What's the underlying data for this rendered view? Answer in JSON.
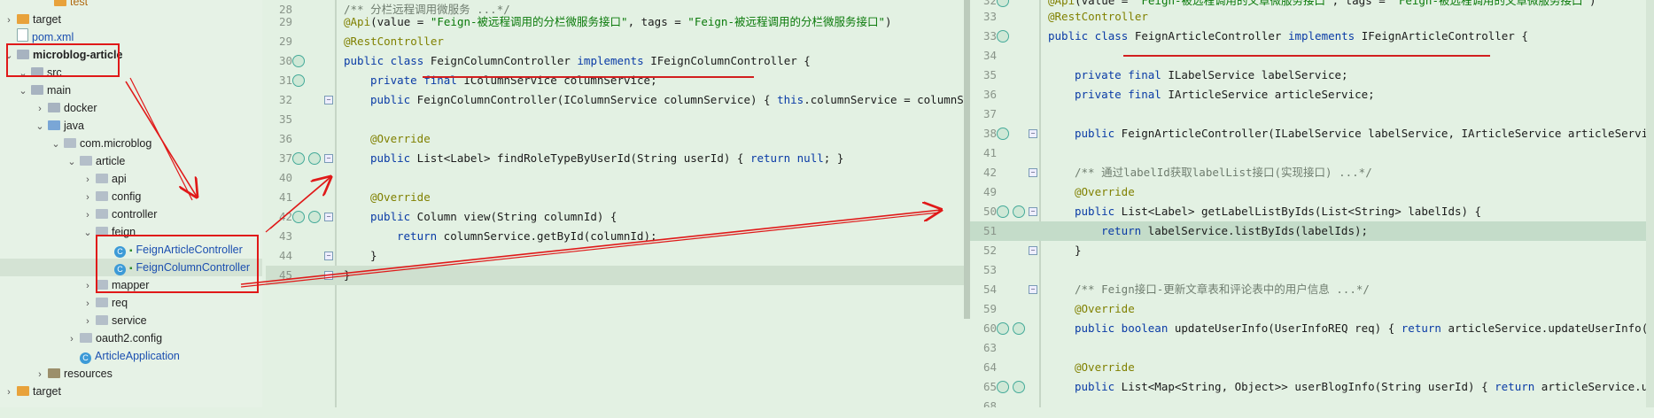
{
  "tree": [
    {
      "label": "test",
      "icon": "orange",
      "indent": 42,
      "chev": "",
      "cls": "orange"
    },
    {
      "label": "target",
      "icon": "orange",
      "indent": 0,
      "chev": "›"
    },
    {
      "label": "pom.xml",
      "icon": "file",
      "indent": 0,
      "chev": "",
      "cls": "blue"
    },
    {
      "label": "microblog-article",
      "icon": "folder",
      "indent": 0,
      "chev": "⌄",
      "cls": "bold"
    },
    {
      "label": "src",
      "icon": "folder",
      "indent": 16,
      "chev": "⌄"
    },
    {
      "label": "main",
      "icon": "folder",
      "indent": 16,
      "chev": "⌄"
    },
    {
      "label": "docker",
      "icon": "folder",
      "indent": 35,
      "chev": "›"
    },
    {
      "label": "java",
      "icon": "src",
      "indent": 35,
      "chev": "⌄"
    },
    {
      "label": "com.microblog",
      "icon": "pkg",
      "indent": 53,
      "chev": "⌄"
    },
    {
      "label": "article",
      "icon": "pkg",
      "indent": 71,
      "chev": "⌄"
    },
    {
      "label": "api",
      "icon": "pkg",
      "indent": 89,
      "chev": "›"
    },
    {
      "label": "config",
      "icon": "pkg",
      "indent": 89,
      "chev": "›"
    },
    {
      "label": "controller",
      "icon": "pkg",
      "indent": 89,
      "chev": "›"
    },
    {
      "label": "feign",
      "icon": "pkg",
      "indent": 89,
      "chev": "⌄"
    },
    {
      "label": "FeignArticleController",
      "icon": "cls",
      "indent": 110,
      "chev": "",
      "cls": "blue",
      "lock": true
    },
    {
      "label": "FeignColumnController",
      "icon": "cls",
      "indent": 110,
      "chev": "",
      "cls": "blue",
      "lock": true,
      "sel": true
    },
    {
      "label": "mapper",
      "icon": "pkg",
      "indent": 89,
      "chev": "›"
    },
    {
      "label": "req",
      "icon": "pkg",
      "indent": 89,
      "chev": "›"
    },
    {
      "label": "service",
      "icon": "pkg",
      "indent": 89,
      "chev": "›"
    },
    {
      "label": "oauth2.config",
      "icon": "pkg",
      "indent": 71,
      "chev": "›"
    },
    {
      "label": "ArticleApplication",
      "icon": "cls",
      "indent": 71,
      "chev": "",
      "cls": "blue"
    },
    {
      "label": "resources",
      "icon": "res",
      "indent": 35,
      "chev": "›"
    },
    {
      "label": "target",
      "icon": "orange",
      "indent": 0,
      "chev": "›"
    },
    {
      "label": "",
      "icon": "",
      "indent": 0,
      "chev": ""
    }
  ],
  "editor1": {
    "lines": [
      {
        "n": "28",
        "html": "<span class=\"cm\">/** 分栏远程调用微服务 ...*/</span>",
        "indent": 0
      },
      {
        "n": "29",
        "html": "<span class=\"an\">@Api</span>(value = <span class=\"st\">\"Feign-被远程调用的分栏微服务接口\"</span>, tags = <span class=\"st\">\"Feign-被远程调用的分栏微服务接口\"</span>)",
        "indent": 0
      },
      {
        "n": "29",
        "html": "<span class=\"an\">@RestController</span>",
        "indent": 0
      },
      {
        "n": "30",
        "html": "<span class=\"kw\">public class</span> FeignColumnController <span class=\"kw\">implements</span> IFeignColumnController {",
        "indent": 0
      },
      {
        "n": "31",
        "html": "<span class=\"kw\">private final</span> IColumnService columnService;",
        "indent": 1
      },
      {
        "n": "32",
        "html": "<span class=\"kw\">public</span> FeignColumnController(IColumnService columnService) { <span class=\"kw\">this</span>.columnService = columnService; }",
        "indent": 1
      },
      {
        "n": "35",
        "html": "",
        "indent": 0
      },
      {
        "n": "36",
        "html": "<span class=\"an\">@Override</span>",
        "indent": 1
      },
      {
        "n": "37",
        "html": "<span class=\"kw\">public</span> List&lt;Label&gt; findRoleTypeByUserId(String userId) { <span class=\"kw\">return null</span>; }",
        "indent": 1
      },
      {
        "n": "40",
        "html": "",
        "indent": 0
      },
      {
        "n": "41",
        "html": "<span class=\"an\">@Override</span>",
        "indent": 1
      },
      {
        "n": "42",
        "html": "<span class=\"kw\">public</span> Column view(String columnId) {",
        "indent": 1
      },
      {
        "n": "43",
        "html": "<span class=\"kw\">return</span> columnService.getById(columnId);",
        "indent": 2
      },
      {
        "n": "44",
        "html": "}",
        "indent": 1
      },
      {
        "n": "45",
        "html": "}",
        "indent": 0
      }
    ]
  },
  "editor2": {
    "lines": [
      {
        "n": "32",
        "html": "<span class=\"an\">@Api</span>(value = <span class=\"st\">\"Feign-被远程调用的文章微服务接口\"</span>, tags = <span class=\"st\">\"Feign-被远程调用的文章微服务接口\"</span>)",
        "indent": 0
      },
      {
        "n": "33",
        "html": "<span class=\"an\">@RestController</span>",
        "indent": 0
      },
      {
        "n": "33",
        "html": "<span class=\"kw\">public class</span> FeignArticleController <span class=\"kw\">implements</span> IFeignArticleController {",
        "indent": 0
      },
      {
        "n": "34",
        "html": "",
        "indent": 0
      },
      {
        "n": "35",
        "html": "<span class=\"kw\">private final</span> ILabelService labelService;",
        "indent": 1
      },
      {
        "n": "36",
        "html": "<span class=\"kw\">private final</span> IArticleService articleService;",
        "indent": 1
      },
      {
        "n": "37",
        "html": "",
        "indent": 0
      },
      {
        "n": "38",
        "html": "<span class=\"kw\">public</span> FeignArticleController(ILabelService labelService, IArticleService articleService) {",
        "indent": 1
      },
      {
        "n": "41",
        "html": "",
        "indent": 0
      },
      {
        "n": "42",
        "html": "<span class=\"cm\">/** 通过labelId获取labelList接口(实现接口) ...*/</span>",
        "indent": 1
      },
      {
        "n": "49",
        "html": "<span class=\"an\">@Override</span>",
        "indent": 1
      },
      {
        "n": "50",
        "html": "<span class=\"kw\">public</span> List&lt;Label&gt; getLabelListByIds(List&lt;String&gt; labelIds) {",
        "indent": 1
      },
      {
        "n": "51",
        "html": "<span class=\"kw\">return</span> labelService.listByIds(labelIds);",
        "indent": 2
      },
      {
        "n": "52",
        "html": "}",
        "indent": 1
      },
      {
        "n": "53",
        "html": "",
        "indent": 0
      },
      {
        "n": "54",
        "html": "<span class=\"cm\">/** Feign接口-更新文章表和评论表中的用户信息 ...*/</span>",
        "indent": 1
      },
      {
        "n": "59",
        "html": "<span class=\"an\">@Override</span>",
        "indent": 1
      },
      {
        "n": "60",
        "html": "<span class=\"kw\">public boolean</span> updateUserInfo(UserInfoREQ req) { <span class=\"kw\">return</span> articleService.updateUserInfo(req); }",
        "indent": 1
      },
      {
        "n": "63",
        "html": "",
        "indent": 0
      },
      {
        "n": "64",
        "html": "<span class=\"an\">@Override</span>",
        "indent": 1
      },
      {
        "n": "65",
        "html": "<span class=\"kw\">public</span> List&lt;Map&lt;String, Object&gt;&gt; userBlogInfo(String userId) { <span class=\"kw\">return</span> articleService.userB",
        "indent": 1
      },
      {
        "n": "68",
        "html": "",
        "indent": 0
      }
    ]
  }
}
